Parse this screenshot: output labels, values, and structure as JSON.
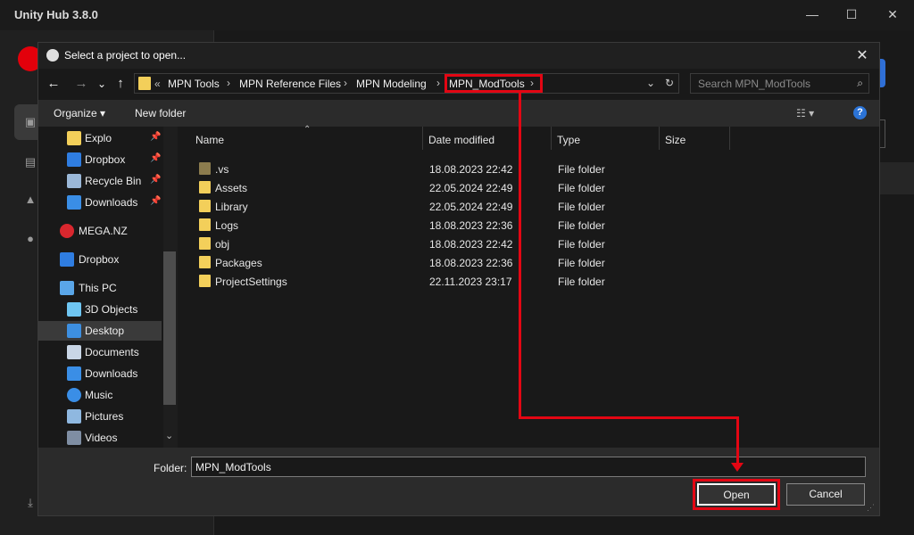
{
  "hub": {
    "title": "Unity Hub 3.8.0",
    "window_controls": [
      "—",
      "☐",
      "✕"
    ]
  },
  "dialog": {
    "title": "Select a project to open...",
    "close": "✕",
    "nav": {
      "back": "←",
      "forward": "→",
      "recent": "⌄",
      "up": "↑"
    },
    "breadcrumb": {
      "overflow": "«",
      "items": [
        "MPN Tools",
        "MPN Reference Files",
        "MPN Modeling",
        "MPN_ModTools"
      ],
      "separator": "›",
      "dropdown": "⌄",
      "refresh": "↻"
    },
    "search": {
      "placeholder": "Search MPN_ModTools"
    },
    "toolbar": {
      "organize": "Organize",
      "new_folder": "New folder",
      "help": "?"
    },
    "navpane": {
      "items": [
        {
          "label": "Explo",
          "icon": "folder-icon",
          "pinned": true
        },
        {
          "label": "Dropbox",
          "icon": "dropbox-icon",
          "pinned": true
        },
        {
          "label": "Recycle Bin",
          "icon": "recycle-bin-icon",
          "pinned": true
        },
        {
          "label": "Downloads",
          "icon": "download-icon",
          "pinned": true
        },
        {
          "label": "MEGA.NZ",
          "icon": "mega-icon",
          "pinned": false
        },
        {
          "label": "Dropbox",
          "icon": "dropbox-icon",
          "pinned": false
        },
        {
          "label": "This PC",
          "icon": "computer-icon",
          "pinned": false
        },
        {
          "label": "3D Objects",
          "icon": "cube-icon",
          "pinned": false
        },
        {
          "label": "Desktop",
          "icon": "desktop-icon",
          "pinned": false,
          "selected": true
        },
        {
          "label": "Documents",
          "icon": "document-icon",
          "pinned": false
        },
        {
          "label": "Downloads",
          "icon": "download-icon",
          "pinned": false
        },
        {
          "label": "Music",
          "icon": "music-icon",
          "pinned": false
        },
        {
          "label": "Pictures",
          "icon": "pictures-icon",
          "pinned": false
        },
        {
          "label": "Videos",
          "icon": "video-icon",
          "pinned": false
        }
      ]
    },
    "columns": [
      "Name",
      "Date modified",
      "Type",
      "Size"
    ],
    "files": [
      {
        "name": ".vs",
        "date": "18.08.2023 22:42",
        "type": "File folder",
        "hidden": true
      },
      {
        "name": "Assets",
        "date": "22.05.2024 22:49",
        "type": "File folder"
      },
      {
        "name": "Library",
        "date": "22.05.2024 22:49",
        "type": "File folder"
      },
      {
        "name": "Logs",
        "date": "18.08.2023 22:36",
        "type": "File folder"
      },
      {
        "name": "obj",
        "date": "18.08.2023 22:42",
        "type": "File folder"
      },
      {
        "name": "Packages",
        "date": "18.08.2023 22:36",
        "type": "File folder"
      },
      {
        "name": "ProjectSettings",
        "date": "22.11.2023 23:17",
        "type": "File folder"
      }
    ],
    "footer": {
      "folder_label": "Folder:",
      "folder_value": "MPN_ModTools",
      "open": "Open",
      "cancel": "Cancel"
    }
  },
  "colors": {
    "annotation": "#e30613",
    "folder": "#f3cf5a",
    "accent_blue": "#2b73d6"
  }
}
